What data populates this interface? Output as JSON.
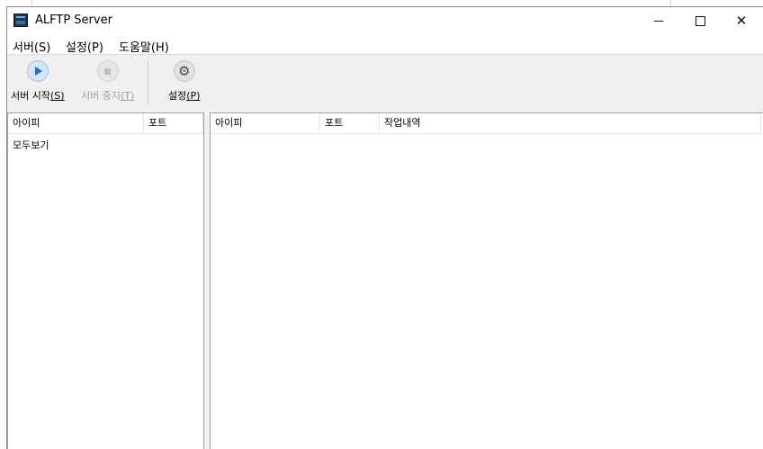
{
  "window": {
    "title": "ALFTP Server"
  },
  "window_controls": {
    "minimize": "minimize",
    "maximize": "maximize",
    "close": "✕"
  },
  "menu": [
    {
      "label": "서버(S)"
    },
    {
      "label": "설정(P)"
    },
    {
      "label": "도움말(H)"
    }
  ],
  "toolbar": {
    "start": {
      "label": "서버 시작",
      "key": "(S)",
      "icon": "play-icon",
      "enabled": true
    },
    "stop": {
      "label": "서버 중지",
      "key": "(T)",
      "icon": "stop-icon",
      "enabled": false
    },
    "settings": {
      "label": "설정",
      "key": "(P)",
      "icon": "gear-icon",
      "enabled": true
    }
  },
  "left_list": {
    "columns": [
      "아이피",
      "포트"
    ],
    "rows": [
      {
        "label": "모두보기"
      }
    ]
  },
  "right_list": {
    "columns": [
      "아이피",
      "포트",
      "작업내역"
    ]
  },
  "colors": {
    "accent": "#1b6ed6",
    "window_bg": "#f0f0f0"
  }
}
